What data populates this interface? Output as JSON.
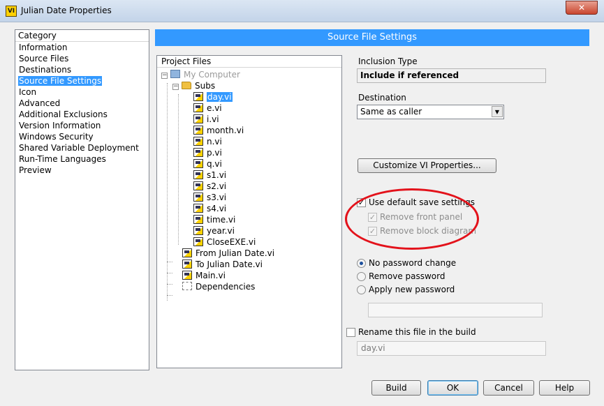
{
  "window": {
    "title": "Julian Date Properties",
    "app_icon_text": "VI",
    "close_glyph": "✕"
  },
  "category": {
    "header": "Category",
    "items": [
      "Information",
      "Source Files",
      "Destinations",
      "Source File Settings",
      "Icon",
      "Advanced",
      "Additional Exclusions",
      "Version Information",
      "Windows Security",
      "Shared Variable Deployment",
      "Run-Time Languages",
      "Preview"
    ],
    "selected": "Source File Settings"
  },
  "section_title": "Source File Settings",
  "project_files": {
    "header": "Project Files",
    "root": "My Computer",
    "subs_folder": "Subs",
    "subs": [
      "day.vi",
      "e.vi",
      "i.vi",
      "month.vi",
      "n.vi",
      "p.vi",
      "q.vi",
      "s1.vi",
      "s2.vi",
      "s3.vi",
      "s4.vi",
      "time.vi",
      "year.vi",
      "CloseEXE.vi"
    ],
    "selected_file": "day.vi",
    "top_level": [
      "From Julian Date.vi",
      "To Julian Date.vi",
      "Main.vi"
    ],
    "dependencies": "Dependencies",
    "collapse_glyph": "−"
  },
  "settings": {
    "inclusion_type_label": "Inclusion Type",
    "inclusion_type_value": "Include if referenced",
    "destination_label": "Destination",
    "destination_value": "Same as caller",
    "dropdown_glyph": "▼",
    "customize_button": "Customize VI Properties...",
    "use_default_save": {
      "label": "Use default save settings",
      "checked": true
    },
    "remove_front_panel": {
      "label": "Remove front panel",
      "checked": true
    },
    "remove_block_diagram": {
      "label": "Remove block diagram",
      "checked": true
    },
    "check_glyph": "✓",
    "password_options": [
      "No password change",
      "Remove password",
      "Apply new password"
    ],
    "password_selected": "No password change",
    "password_value": "",
    "rename_label": "Rename this file in the build",
    "rename_checked": false,
    "rename_value": "day.vi"
  },
  "buttons": {
    "build": "Build",
    "ok": "OK",
    "cancel": "Cancel",
    "help": "Help"
  },
  "annotation_color": "#e3121b",
  "accent_color": "#3399ff"
}
